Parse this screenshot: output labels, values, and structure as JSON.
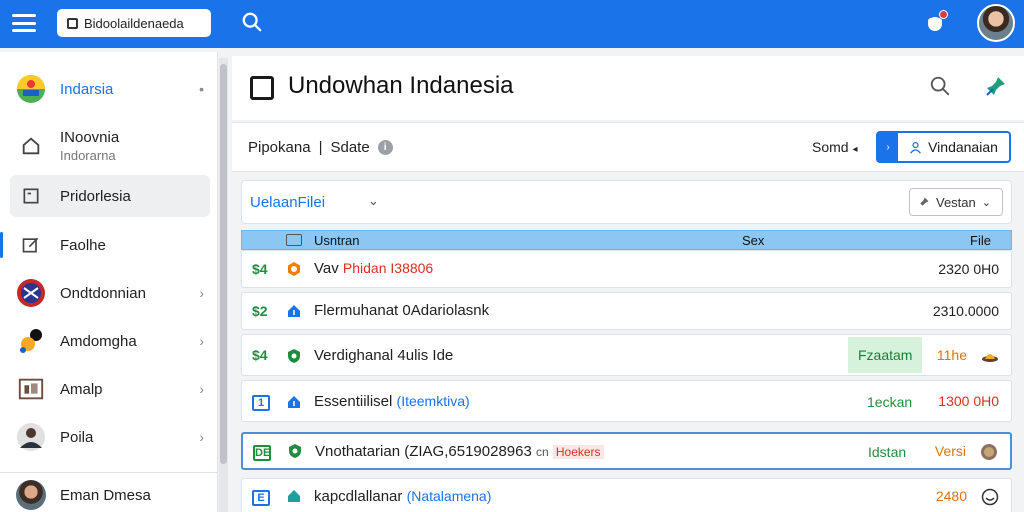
{
  "topbar": {
    "app_name": "Bidoolaildenaeda"
  },
  "sidebar": {
    "items": [
      {
        "label": "Indarsia",
        "sub": "",
        "arrow": "•"
      },
      {
        "label": "INoovnia",
        "sub": "Indorarna",
        "arrow": ""
      },
      {
        "label": "Pridorlesia",
        "sub": "",
        "arrow": ""
      },
      {
        "label": "Faolhe",
        "sub": "",
        "arrow": ""
      },
      {
        "label": "Ondtdonnian",
        "sub": "",
        "arrow": "›"
      },
      {
        "label": "Amdomgha",
        "sub": "",
        "arrow": "›"
      },
      {
        "label": "Amalp",
        "sub": "",
        "arrow": "›"
      },
      {
        "label": "Poila",
        "sub": "",
        "arrow": "›"
      }
    ],
    "user": {
      "name": "Eman Dmesa"
    }
  },
  "main": {
    "title": "Undowhan Indanesia",
    "subheader": {
      "left": "Pipokana",
      "separator": "|",
      "state": "Sdate",
      "sort": "Somd",
      "primary_button": "Vindanaian"
    },
    "filter": {
      "label": "UelaanFilei",
      "version": "Vestan"
    },
    "table": {
      "headers": {
        "name": "Usntran",
        "size": "Sex",
        "file": "File"
      },
      "rows": [
        {
          "num": "$4",
          "name": "Vav",
          "highlight": "Phidan I38806",
          "mid": "",
          "value": "2320 0H0"
        },
        {
          "num": "$2",
          "name": "Flermuhanat 0Adariolasnk",
          "highlight": "",
          "mid": "",
          "value": "2310.0000"
        },
        {
          "num": "$4",
          "name": "Verdighanal 4ulis Ide",
          "highlight": "",
          "mid": "Fzaatam",
          "value": "11he"
        },
        {
          "num": "1",
          "name": "Essentiilisel",
          "highlight": "(Iteemktiva)",
          "mid": "1eckan",
          "value": "1300 0H0"
        },
        {
          "num": "DE",
          "name": "Vnothatarian (ZIAG,6519028963",
          "highlight": "Hoekers",
          "prefix": "cn",
          "mid": "Idstan",
          "value": "Versi"
        },
        {
          "num": "E",
          "name": "kapcdlallanar",
          "highlight": "(Natalamena)",
          "mid": "",
          "value": "2480"
        }
      ]
    }
  },
  "colors": {
    "primary": "#1a73e8",
    "green": "#1e8e3e",
    "red": "#d93025"
  }
}
